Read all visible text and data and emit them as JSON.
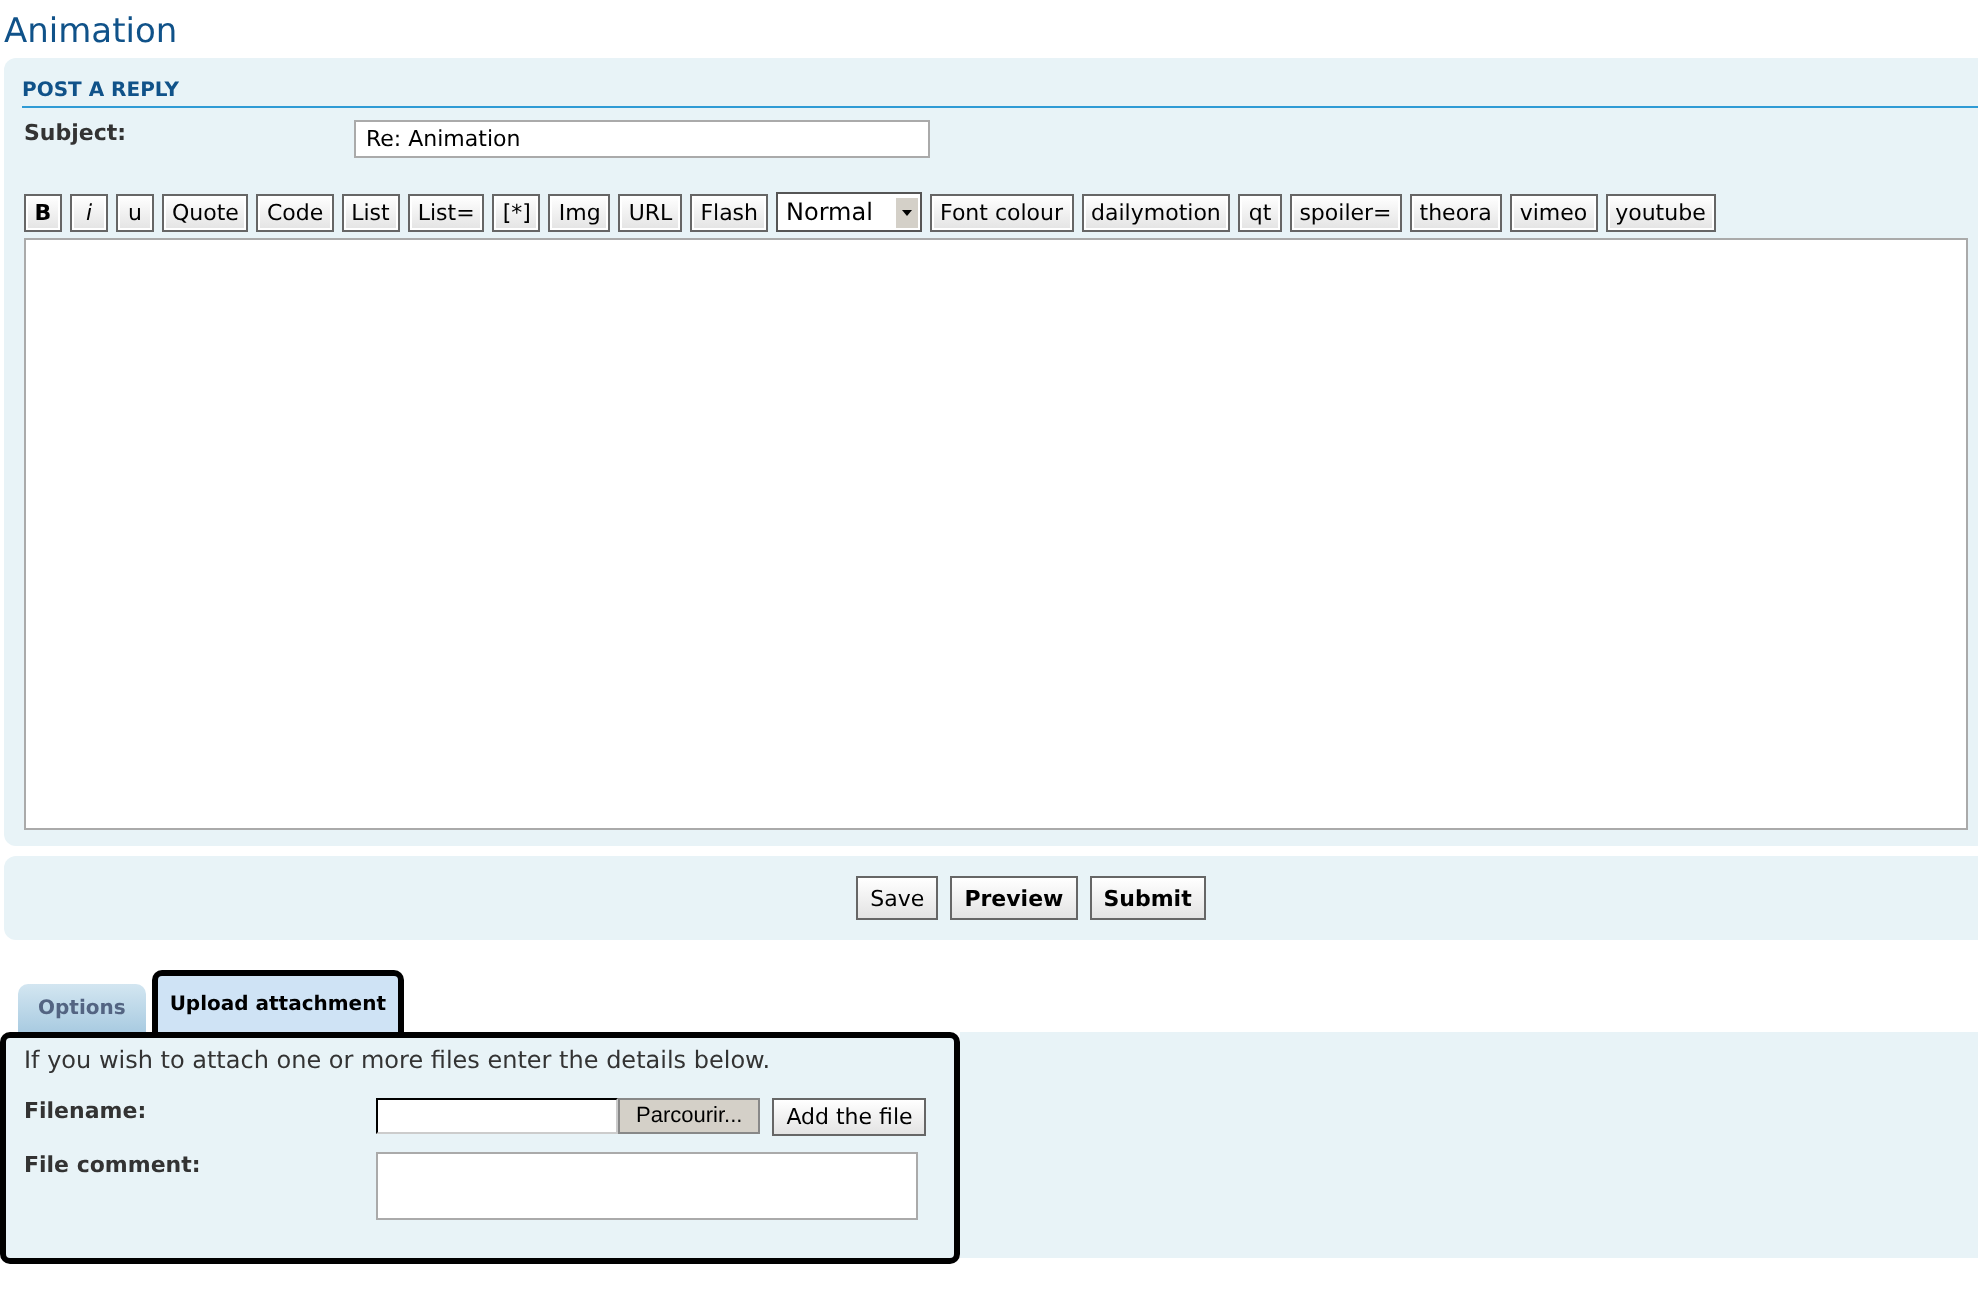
{
  "page_title": "Animation",
  "post_panel": {
    "heading": "POST A REPLY",
    "subject_label": "Subject:",
    "subject_value": "Re: Animation",
    "toolbar": [
      {
        "label": "B",
        "kind": "bold"
      },
      {
        "label": "i",
        "kind": "italic"
      },
      {
        "label": "u",
        "kind": "underline"
      },
      {
        "label": "Quote",
        "kind": "plain"
      },
      {
        "label": "Code",
        "kind": "plain"
      },
      {
        "label": "List",
        "kind": "plain"
      },
      {
        "label": "List=",
        "kind": "plain"
      },
      {
        "label": "[*]",
        "kind": "plain"
      },
      {
        "label": "Img",
        "kind": "plain"
      },
      {
        "label": "URL",
        "kind": "plain"
      },
      {
        "label": "Flash",
        "kind": "plain"
      },
      {
        "label": "Normal",
        "kind": "select"
      },
      {
        "label": "Font colour",
        "kind": "plain"
      },
      {
        "label": "dailymotion",
        "kind": "plain"
      },
      {
        "label": "qt",
        "kind": "plain"
      },
      {
        "label": "spoiler=",
        "kind": "plain"
      },
      {
        "label": "theora",
        "kind": "plain"
      },
      {
        "label": "vimeo",
        "kind": "plain"
      },
      {
        "label": "youtube",
        "kind": "plain"
      }
    ]
  },
  "actions": [
    {
      "label": "Save",
      "bold": false
    },
    {
      "label": "Preview",
      "bold": true
    },
    {
      "label": "Submit",
      "bold": true
    }
  ],
  "tabs": [
    {
      "label": "Options",
      "selected": false
    },
    {
      "label": "Upload attachment",
      "selected": true
    }
  ],
  "attachment": {
    "intro": "If you wish to attach one or more files enter the details below.",
    "filename_label": "Filename:",
    "browse_button": "Parcourir...",
    "add_button": "Add the file",
    "comment_label": "File comment:"
  }
}
